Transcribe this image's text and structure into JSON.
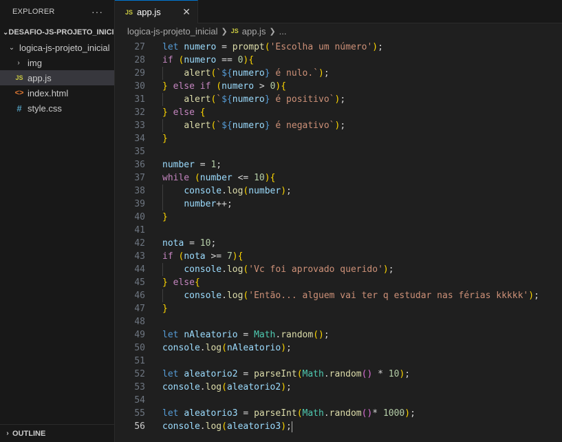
{
  "sidebar": {
    "title": "EXPLORER",
    "more": "···",
    "project": "DESAFIO-JS-PROJETO_INICI...",
    "folder": "logica-js-projeto_inicial",
    "items": [
      {
        "name": "img",
        "type": "folder"
      },
      {
        "name": "app.js",
        "type": "js",
        "icon_label": "JS"
      },
      {
        "name": "index.html",
        "type": "html",
        "icon_label": "<>"
      },
      {
        "name": "style.css",
        "type": "css",
        "icon_label": "#"
      }
    ],
    "outline": "OUTLINE"
  },
  "tab": {
    "label": "app.js",
    "icon_label": "JS",
    "close": "✕"
  },
  "breadcrumb": {
    "folder": "logica-js-projeto_inicial",
    "file": "app.js",
    "more": "..."
  },
  "editor": {
    "current_line": 56,
    "lines": [
      {
        "n": 27,
        "text": "let numero = prompt('Escolha um número');"
      },
      {
        "n": 28,
        "text": "if (numero == 0){"
      },
      {
        "n": 29,
        "text": "    alert(`${numero} é nulo.`);"
      },
      {
        "n": 30,
        "text": "} else if (numero > 0){"
      },
      {
        "n": 31,
        "text": "    alert(`${numero} é positivo`);"
      },
      {
        "n": 32,
        "text": "} else {"
      },
      {
        "n": 33,
        "text": "    alert(`${numero} é negativo`);"
      },
      {
        "n": 34,
        "text": "}"
      },
      {
        "n": 35,
        "text": ""
      },
      {
        "n": 36,
        "text": "number = 1;"
      },
      {
        "n": 37,
        "text": "while (number <= 10){"
      },
      {
        "n": 38,
        "text": "    console.log(number);"
      },
      {
        "n": 39,
        "text": "    number++;"
      },
      {
        "n": 40,
        "text": "}"
      },
      {
        "n": 41,
        "text": ""
      },
      {
        "n": 42,
        "text": "nota = 10;"
      },
      {
        "n": 43,
        "text": "if (nota >= 7){"
      },
      {
        "n": 44,
        "text": "    console.log('Vc foi aprovado querido');"
      },
      {
        "n": 45,
        "text": "} else{"
      },
      {
        "n": 46,
        "text": "    console.log('Então... alguem vai ter q estudar nas férias kkkkk');"
      },
      {
        "n": 47,
        "text": "}"
      },
      {
        "n": 48,
        "text": ""
      },
      {
        "n": 49,
        "text": "let nAleatorio = Math.random();"
      },
      {
        "n": 50,
        "text": "console.log(nAleatorio);"
      },
      {
        "n": 51,
        "text": ""
      },
      {
        "n": 52,
        "text": "let aleatorio2 = parseInt(Math.random() * 10);"
      },
      {
        "n": 53,
        "text": "console.log(aleatorio2);"
      },
      {
        "n": 54,
        "text": ""
      },
      {
        "n": 55,
        "text": "let aleatorio3 = parseInt(Math.random()* 1000);"
      },
      {
        "n": 56,
        "text": "console.log(aleatorio3);"
      }
    ]
  },
  "colors": {
    "accent": "#0078d4",
    "sidebar_bg": "#181818",
    "editor_bg": "#1f1f1f",
    "keyword": "#569cd6",
    "control": "#c586c0",
    "variable": "#9cdcfe",
    "function": "#dcdcaa",
    "string": "#ce9178",
    "number": "#b5cea8"
  }
}
